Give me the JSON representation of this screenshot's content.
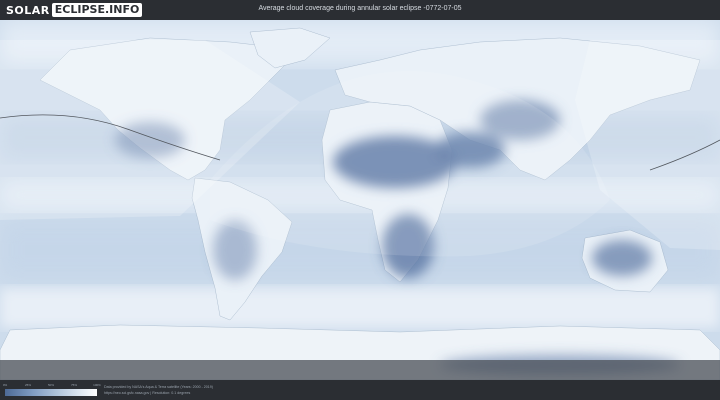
{
  "header": {
    "logo_part1": "SOLAR",
    "logo_part2": "ECLIPSE.INFO",
    "title": "Average cloud coverage during annular solar eclipse -0772-07-05"
  },
  "legend": {
    "ticks": [
      "0%",
      "25%",
      "50%",
      "75%",
      "100%"
    ],
    "colors": [
      "#4d6a96",
      "#7f9cc2",
      "#b6c9de",
      "#e4ecf5",
      "#ffffff"
    ]
  },
  "footer": {
    "credit_line1": "Data provided by NASA's Aqua & Terra satellite (Years: 2000 - 2019)",
    "credit_line2": "https://neo.sci.gsfc.nasa.gov | Resolution: 0.1 degrees"
  },
  "map": {
    "land_color": "#eef3f8",
    "cloudy_color": "#dfe9f4",
    "clear_color": "#5a76a3",
    "ocean_color": "#c9d9ea",
    "path_color": "#50555c"
  }
}
